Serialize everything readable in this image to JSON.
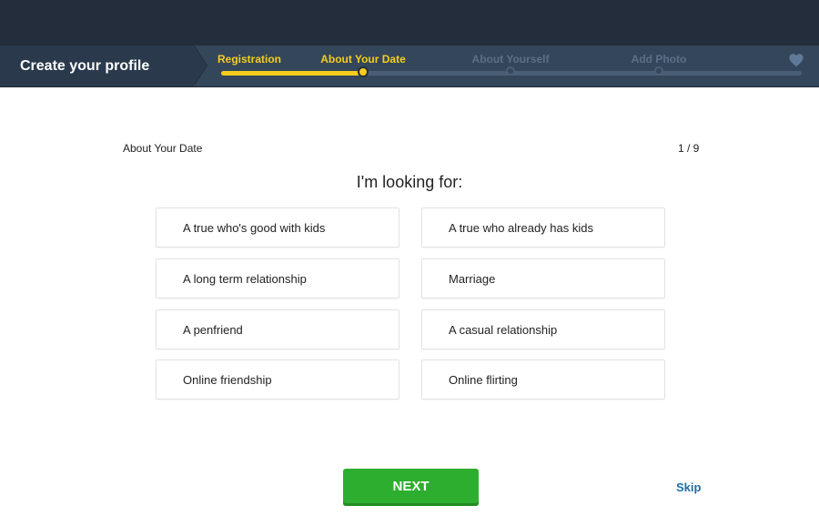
{
  "header": {
    "title": "Create your profile",
    "steps": [
      {
        "label": "Registration",
        "state": "done"
      },
      {
        "label": "About Your Date",
        "state": "active"
      },
      {
        "label": "About Yourself",
        "state": "todo"
      },
      {
        "label": "Add Photo",
        "state": "todo"
      }
    ],
    "progress_fraction": 0.245,
    "end_icon": "heart-icon"
  },
  "main": {
    "section_label": "About Your Date",
    "progress_count": "1 / 9",
    "question": "I'm looking for:",
    "options": [
      {
        "label": "A true who's good with kids"
      },
      {
        "label": "A true who already has kids"
      },
      {
        "label": "A long term relationship"
      },
      {
        "label": "Marriage"
      },
      {
        "label": "A penfriend"
      },
      {
        "label": "A casual relationship"
      },
      {
        "label": "Online friendship"
      },
      {
        "label": "Online flirting"
      }
    ]
  },
  "actions": {
    "next_label": "NEXT",
    "skip_label": "Skip"
  },
  "colors": {
    "accent_yellow": "#f5cd1e",
    "next_green": "#2eae2e",
    "link_blue": "#1e6fa5",
    "header_dark": "#232d3b"
  }
}
